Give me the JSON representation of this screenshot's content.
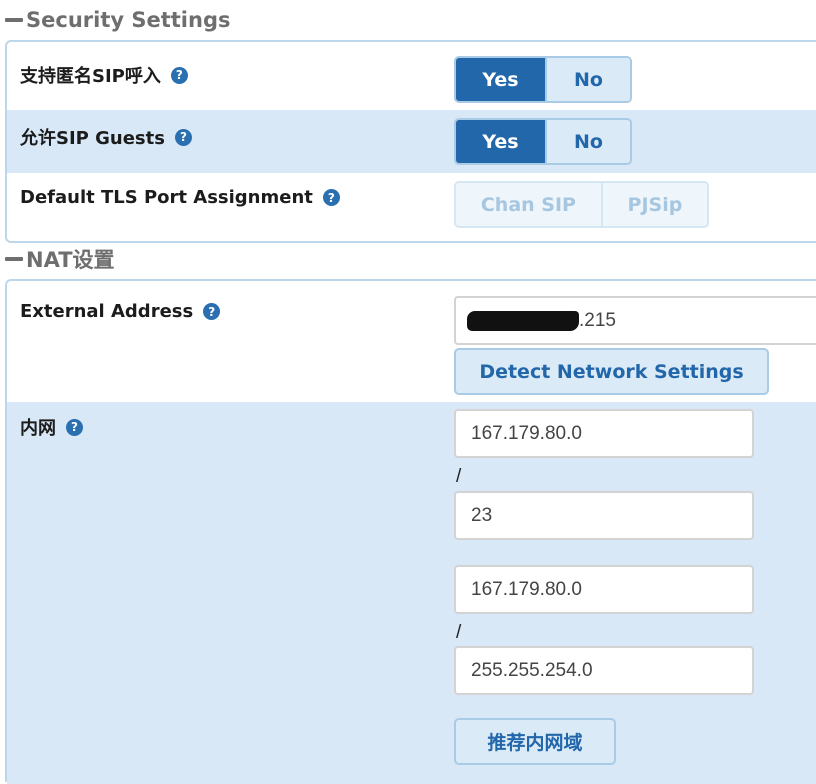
{
  "security": {
    "title": "Security Settings",
    "rows": [
      {
        "label": "支持匿名SIP呼入",
        "options": [
          "Yes",
          "No"
        ],
        "selected": "Yes"
      },
      {
        "label": "允许SIP Guests",
        "options": [
          "Yes",
          "No"
        ],
        "selected": "Yes"
      },
      {
        "label": "Default TLS Port Assignment",
        "options": [
          "Chan SIP",
          "PJSip"
        ],
        "selected": null,
        "disabled": true
      }
    ]
  },
  "nat": {
    "title": "NAT设置",
    "external_address": {
      "label": "External Address",
      "value_suffix": ".215",
      "detect_button": "Detect Network Settings"
    },
    "local_network": {
      "label": "内网",
      "entries": [
        {
          "network": "167.179.80.0",
          "mask": "23"
        },
        {
          "network": "167.179.80.0",
          "mask": "255.255.254.0"
        }
      ],
      "separator": "/",
      "recommend_button": "推荐内网域"
    }
  },
  "icons": {
    "help": "?",
    "collapse": "dash"
  },
  "colors": {
    "accent": "#2367ab",
    "row_shade": "#d8e8f6",
    "border": "#bcd7ea"
  }
}
